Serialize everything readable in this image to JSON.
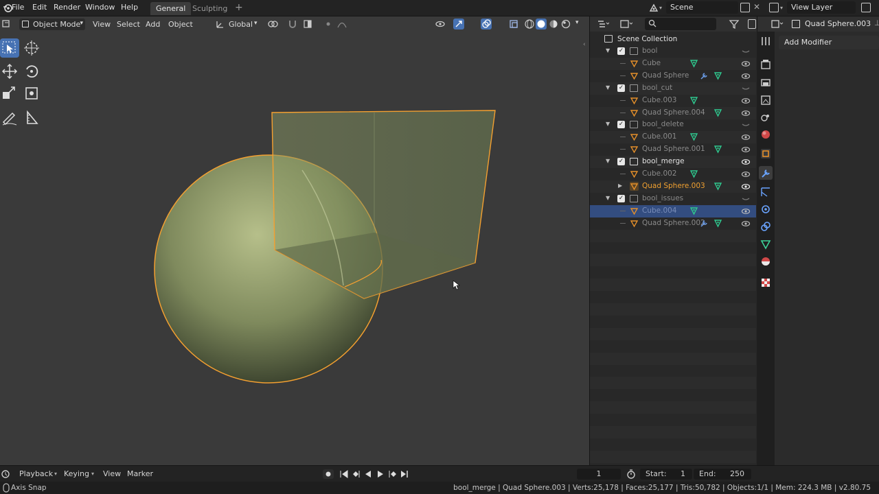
{
  "menubar": {
    "items": [
      "File",
      "Edit",
      "Render",
      "Window",
      "Help"
    ],
    "workspaces": [
      "General",
      "Sculpting"
    ],
    "add_tab_label": "+",
    "scene_name": "Scene",
    "view_layer": "View Layer"
  },
  "viewport_header": {
    "mode": "Object Mode",
    "menus": [
      "View",
      "Select",
      "Add",
      "Object"
    ],
    "transform_orientation": "Global"
  },
  "outliner": {
    "search_placeholder": "",
    "root": "Scene Collection",
    "rows": [
      {
        "label": "bool",
        "type": "collection",
        "state": "dim"
      },
      {
        "label": "Cube",
        "type": "object",
        "state": "dim"
      },
      {
        "label": "Quad Sphere",
        "type": "object",
        "state": "dim"
      },
      {
        "label": "bool_cut",
        "type": "collection",
        "state": "dim"
      },
      {
        "label": "Cube.003",
        "type": "object",
        "state": "dim"
      },
      {
        "label": "Quad Sphere.004",
        "type": "object",
        "state": "dim"
      },
      {
        "label": "bool_delete",
        "type": "collection",
        "state": "dim"
      },
      {
        "label": "Cube.001",
        "type": "object",
        "state": "dim"
      },
      {
        "label": "Quad Sphere.001",
        "type": "object",
        "state": "dim"
      },
      {
        "label": "bool_merge",
        "type": "collection",
        "state": "bright"
      },
      {
        "label": "Cube.002",
        "type": "object",
        "state": "dim"
      },
      {
        "label": "Quad Sphere.003",
        "type": "object",
        "state": "active"
      },
      {
        "label": "bool_issues",
        "type": "collection",
        "state": "dim"
      },
      {
        "label": "Cube.004",
        "type": "object",
        "state": "selected"
      },
      {
        "label": "Quad Sphere.002",
        "type": "object",
        "state": "dim"
      }
    ]
  },
  "properties": {
    "object_name": "Quad Sphere.003",
    "add_modifier_label": "Add Modifier"
  },
  "timeline": {
    "menus": [
      "Playback",
      "Keying",
      "View",
      "Marker"
    ],
    "current_frame": "1",
    "start_label": "Start:",
    "start_value": "1",
    "end_label": "End:",
    "end_value": "250"
  },
  "statusbar": {
    "left": "Axis Snap",
    "right": "bool_merge | Quad Sphere.003 | Verts:25,178 | Faces:25,177 | Tris:50,782 | Objects:1/1 | Mem: 224.3 MB | v2.80.75"
  },
  "colors": {
    "accent": "#4772b3",
    "active_orange": "#f0a030",
    "selection_outline": "#f5a030"
  }
}
